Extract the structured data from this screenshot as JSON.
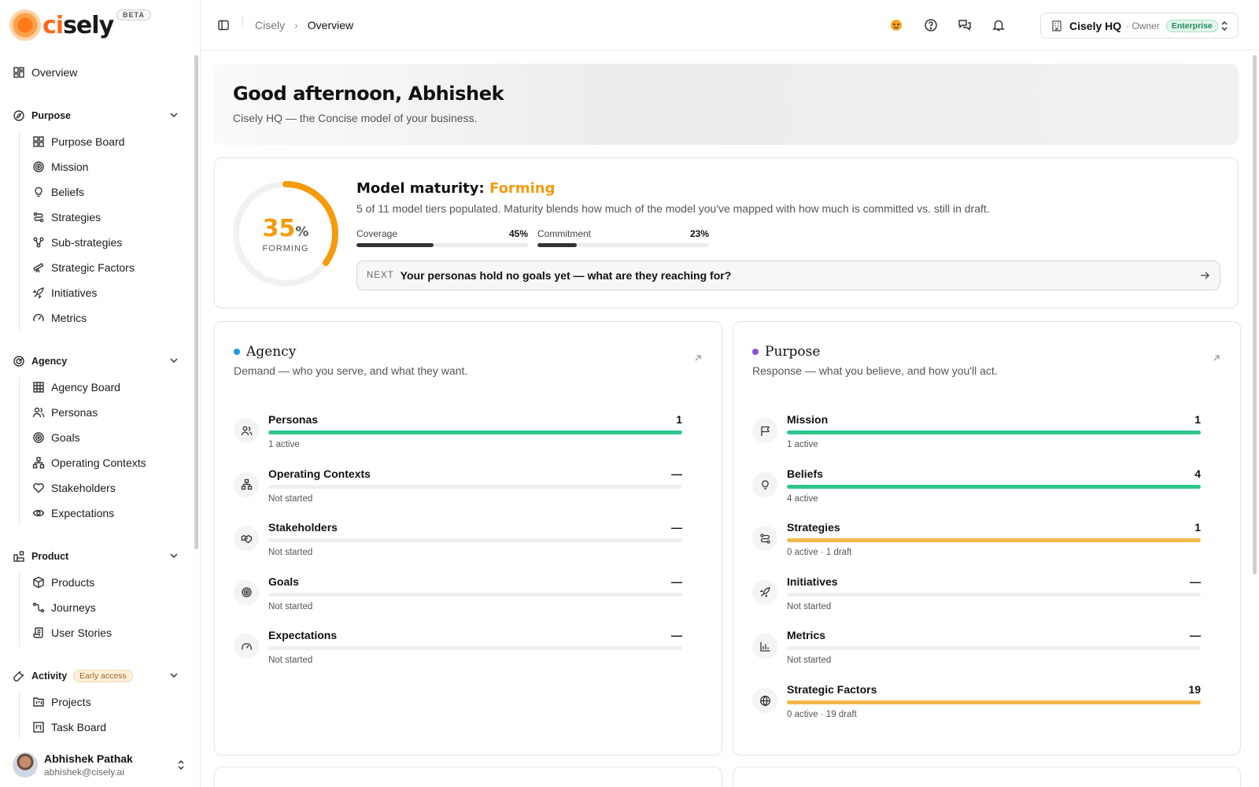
{
  "brand": {
    "name_a": "ci",
    "name_b": "sely",
    "badge": "BETA"
  },
  "sidebar": {
    "overview": "Overview",
    "groups": [
      {
        "label": "Purpose",
        "items": [
          "Purpose Board",
          "Mission",
          "Beliefs",
          "Strategies",
          "Sub-strategies",
          "Strategic Factors",
          "Initiatives",
          "Metrics"
        ]
      },
      {
        "label": "Agency",
        "items": [
          "Agency Board",
          "Personas",
          "Goals",
          "Operating Contexts",
          "Stakeholders",
          "Expectations"
        ]
      },
      {
        "label": "Product",
        "items": [
          "Products",
          "Journeys",
          "User Stories"
        ]
      },
      {
        "label": "Activity",
        "badge": "Early access",
        "items": [
          "Projects",
          "Task Board"
        ]
      }
    ],
    "user": {
      "name": "Abhishek Pathak",
      "email": "abhishek@cisely.ai"
    }
  },
  "topbar": {
    "breadcrumb": [
      "Cisely",
      "Overview"
    ],
    "org": {
      "name": "Cisely HQ",
      "role": "· Owner",
      "plan": "Enterprise"
    }
  },
  "hero": {
    "greeting": "Good afternoon, Abhishek",
    "subtitle": "Cisely HQ — the Concise model of your business."
  },
  "maturity": {
    "percent": 35,
    "percent_text": "35",
    "percent_sign": "%",
    "stage": "FORMING",
    "title": "Model maturity:",
    "level": "Forming",
    "description": "5 of 11 model tiers populated. Maturity blends how much of the model you've mapped with how much is committed vs. still in draft.",
    "coverage": {
      "label": "Coverage",
      "value": "45%",
      "fraction": 0.45
    },
    "commitment": {
      "label": "Commitment",
      "value": "23%",
      "fraction": 0.23
    },
    "next": {
      "tag": "NEXT",
      "text": "Your personas hold no goals yet — what are they reaching for?"
    }
  },
  "agency": {
    "title": "Agency",
    "subtitle": "Demand — who you serve, and what they want.",
    "color": "#1a9be0",
    "rows": [
      {
        "name": "Personas",
        "value": "1",
        "status": "1 active",
        "fill": 1.0,
        "color": "#2fc48a",
        "icon": "users-icon"
      },
      {
        "name": "Operating Contexts",
        "value": "—",
        "status": "Not started",
        "fill": 0,
        "color": "#2fc48a",
        "icon": "network-icon"
      },
      {
        "name": "Stakeholders",
        "value": "—",
        "status": "Not started",
        "fill": 0,
        "color": "#2fc48a",
        "icon": "handshake-icon"
      },
      {
        "name": "Goals",
        "value": "—",
        "status": "Not started",
        "fill": 0,
        "color": "#2fc48a",
        "icon": "target-icon"
      },
      {
        "name": "Expectations",
        "value": "—",
        "status": "Not started",
        "fill": 0,
        "color": "#2fc48a",
        "icon": "gauge-icon"
      }
    ]
  },
  "purpose": {
    "title": "Purpose",
    "subtitle": "Response — what you believe, and how you'll act.",
    "color": "#8a4fe0",
    "rows": [
      {
        "name": "Mission",
        "value": "1",
        "status": "1 active",
        "fill": 1.0,
        "color": "#2fc48a",
        "icon": "flag-icon"
      },
      {
        "name": "Beliefs",
        "value": "4",
        "status": "4 active",
        "fill": 1.0,
        "color": "#2fc48a",
        "icon": "lightbulb-icon"
      },
      {
        "name": "Strategies",
        "value": "1",
        "status": "0 active · 1 draft",
        "fill": 1.0,
        "color": "#f2b84b",
        "icon": "route-icon"
      },
      {
        "name": "Initiatives",
        "value": "—",
        "status": "Not started",
        "fill": 0,
        "color": "#2fc48a",
        "icon": "rocket-icon"
      },
      {
        "name": "Metrics",
        "value": "—",
        "status": "Not started",
        "fill": 0,
        "color": "#2fc48a",
        "icon": "bar-chart-icon"
      },
      {
        "name": "Strategic Factors",
        "value": "19",
        "status": "0 active · 19 draft",
        "fill": 1.0,
        "color": "#f2b84b",
        "icon": "globe-icon"
      }
    ]
  }
}
